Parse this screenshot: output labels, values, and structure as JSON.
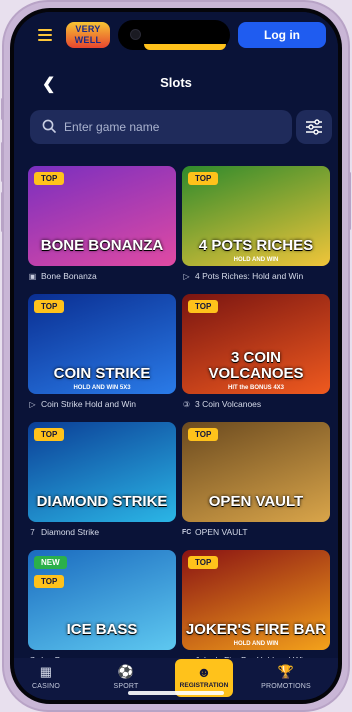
{
  "header": {
    "logo_text": "VERY WELL",
    "login_label": "Log in",
    "page_title": "Slots",
    "back_icon": "chevron-left-icon"
  },
  "search": {
    "placeholder": "Enter game name",
    "filter_icon": "sliders-icon"
  },
  "games": [
    {
      "badge": "TOP",
      "title": "BONE BONANZA",
      "caption": "Bone Bonanza",
      "provider_icon": "square-b-icon",
      "colors": [
        "#7a2fbf",
        "#e04aa3"
      ]
    },
    {
      "badge": "TOP",
      "title": "4 POTS RICHES",
      "subtitle": "HOLD AND WIN",
      "caption": "4 Pots Riches: Hold and Win",
      "provider_icon": "play-outline-icon",
      "colors": [
        "#2f8a2c",
        "#f0c53a"
      ]
    },
    {
      "badge": "TOP",
      "title": "COIN STRIKE",
      "subtitle": "HOLD AND WIN 5X3",
      "caption": "Coin Strike Hold and Win",
      "provider_icon": "play-outline-icon",
      "colors": [
        "#0a2e91",
        "#2a7be8"
      ]
    },
    {
      "badge": "TOP",
      "title": "3 COIN VOLCANOES",
      "subtitle": "HIT the BONUS 4X3",
      "caption": "3 Coin Volcanoes",
      "provider_icon": "circle-3-icon",
      "colors": [
        "#7a1511",
        "#ef5a1f"
      ]
    },
    {
      "badge": "TOP",
      "title": "DIAMOND STRIKE",
      "caption": "Diamond Strike",
      "provider_icon": "seven-icon",
      "colors": [
        "#0b3e96",
        "#2bb6e6"
      ]
    },
    {
      "badge": "TOP",
      "title": "OPEN VAULT",
      "caption": "OPEN VAULT",
      "provider_icon": "fc-logo-icon",
      "colors": [
        "#6b4a1f",
        "#d9a54a"
      ]
    },
    {
      "badge": "NEW",
      "badge2": "TOP",
      "title": "ICE BASS",
      "caption": "Ice Bass",
      "provider_icon": "seven-icon",
      "colors": [
        "#1b6bbf",
        "#5ec8f0"
      ]
    },
    {
      "badge": "TOP",
      "title": "JOKER'S FIRE BAR",
      "subtitle": "HOLD AND WIN",
      "caption": "Joker's Fire Bar Hold and Win",
      "provider_icon": "play-outline-icon",
      "colors": [
        "#8a1313",
        "#f4a21b"
      ]
    }
  ],
  "bottom_nav": {
    "casino": "CASINO",
    "sport": "SPORT",
    "registration": "REGISTRATION",
    "promotions": "PROMOTIONS"
  }
}
